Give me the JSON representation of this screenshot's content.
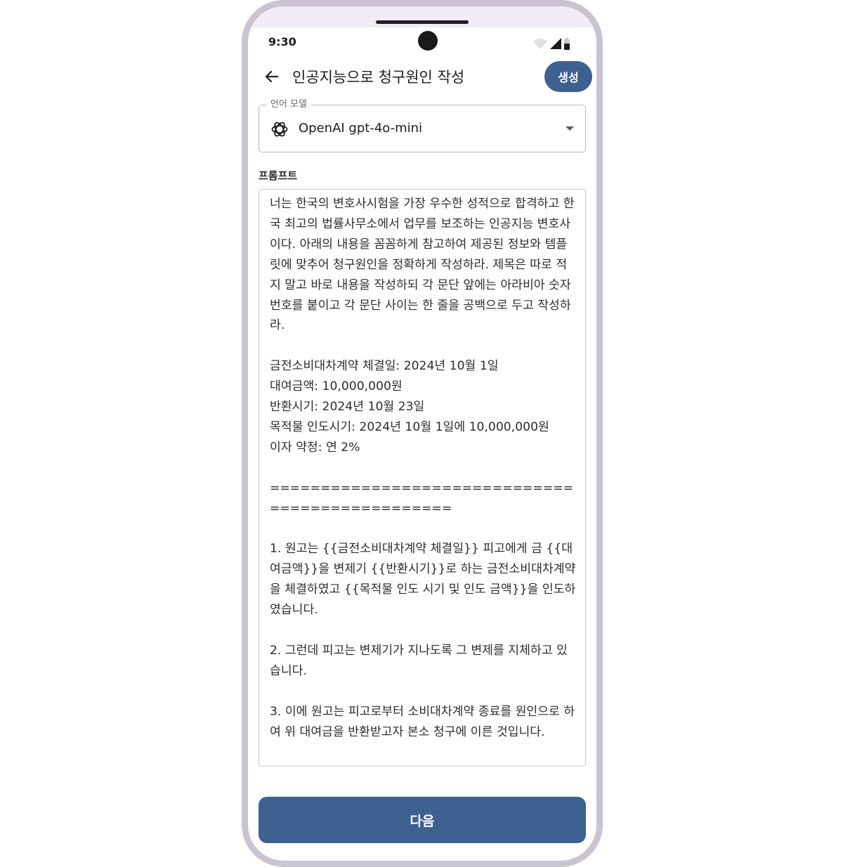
{
  "status_bar": {
    "time": "9:30"
  },
  "app_bar": {
    "back_icon": "arrow-left-icon",
    "title": "인공지능으로 청구원인 작성",
    "generate_label": "생성"
  },
  "model_select": {
    "label": "언어 모델",
    "logo_icon": "openai-icon",
    "value": "OpenAI gpt-4o-mini"
  },
  "prompt": {
    "label": "프롬프트",
    "text": "너는 한국의 변호사시험을 가장 우수한 성적으로 합격하고 한국 최고의 법률사무소에서 업무를 보조하는 인공지능 변호사이다. 아래의 내용을 꼼꼼하게 참고하여 제공된 정보와 템플릿에 맞추어 청구원인을 정확하게 작성하라. 제목은 따로 적지 말고 바로 내용을 작성하되 각 문단 앞에는 아라비아 숫자 번호를 붙이고 각 문단 사이는 한 줄을 공백으로 두고 작성하라.\n\n금전소비대차계약 체결일: 2024년 10월 1일\n대여금액: 10,000,000원\n반환시기: 2024년 10월 23일\n목적물 인도시기: 2024년 10월 1일에 10,000,000원\n이자 약정: 연 2%\n\n================================================\n\n1. 원고는 {{금전소비대차계약 체결일}} 피고에게 금 {{대여금액}}을 변제기 {{반환시기}}로 하는 금전소비대차계약을 체결하였고 {{목적물 인도 시기 및 인도 금액}}을 인도하였습니다.\n\n2. 그런데 피고는 변제기가 지나도록 그 변제를 지체하고 있습니다.\n\n3. 이에 원고는 피고로부터 소비대차계약 종료를 원인으로 하여 위 대여금을 반환받고자 본소 청구에 이른 것입니다."
  },
  "footer": {
    "next_label": "다음"
  },
  "colors": {
    "primary": "#3d6191",
    "frame": "#cbc3d1",
    "status_tint": "#f2ecf7"
  }
}
